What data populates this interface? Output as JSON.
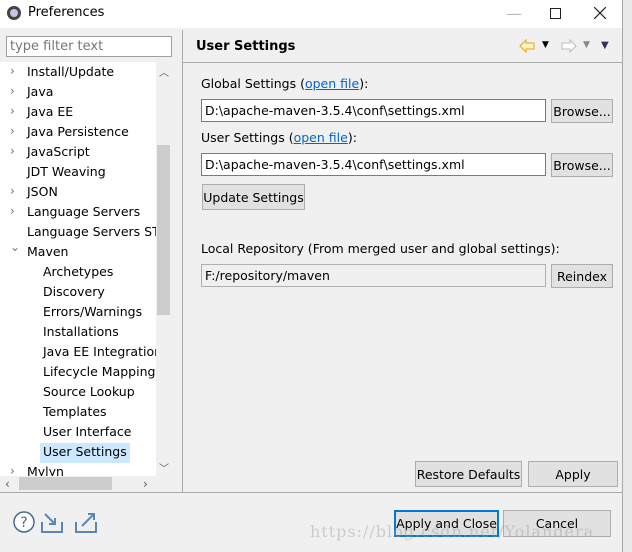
{
  "window": {
    "title": "Preferences",
    "app_icon": "eclipse-gear-icon"
  },
  "filter": {
    "placeholder": "type filter text",
    "value": ""
  },
  "tree": {
    "items": [
      {
        "label": "Install/Update",
        "level": 0,
        "expander": "collapsed"
      },
      {
        "label": "Java",
        "level": 0,
        "expander": "collapsed"
      },
      {
        "label": "Java EE",
        "level": 0,
        "expander": "collapsed"
      },
      {
        "label": "Java Persistence",
        "level": 0,
        "expander": "collapsed"
      },
      {
        "label": "JavaScript",
        "level": 0,
        "expander": "collapsed"
      },
      {
        "label": "JDT Weaving",
        "level": 0,
        "expander": "none"
      },
      {
        "label": "JSON",
        "level": 0,
        "expander": "collapsed"
      },
      {
        "label": "Language Servers",
        "level": 0,
        "expander": "collapsed"
      },
      {
        "label": "Language Servers STS",
        "level": 0,
        "expander": "none"
      },
      {
        "label": "Maven",
        "level": 0,
        "expander": "expanded"
      },
      {
        "label": "Archetypes",
        "level": 1
      },
      {
        "label": "Discovery",
        "level": 1
      },
      {
        "label": "Errors/Warnings",
        "level": 1
      },
      {
        "label": "Installations",
        "level": 1
      },
      {
        "label": "Java EE Integration",
        "level": 1
      },
      {
        "label": "Lifecycle Mappings",
        "level": 1
      },
      {
        "label": "Source Lookup",
        "level": 1
      },
      {
        "label": "Templates",
        "level": 1
      },
      {
        "label": "User Interface",
        "level": 1
      },
      {
        "label": "User Settings",
        "level": 1,
        "selected": true
      },
      {
        "label": "Mylyn",
        "level": 0,
        "expander": "collapsed"
      }
    ]
  },
  "page": {
    "title": "User Settings",
    "global": {
      "label": "Global Settings (",
      "link": "open file",
      "suffix": "):",
      "value": "D:\\apache-maven-3.5.4\\conf\\settings.xml",
      "browse": "Browse..."
    },
    "user": {
      "label": "User Settings (",
      "link": "open file",
      "suffix": "):",
      "value": "D:\\apache-maven-3.5.4\\conf\\settings.xml",
      "browse": "Browse..."
    },
    "update_button": "Update Settings",
    "local": {
      "label": "Local Repository (From merged user and global settings):",
      "value": "F:/repository/maven",
      "reindex": "Reindex"
    },
    "restore_defaults": "Restore Defaults",
    "apply": "Apply"
  },
  "footer": {
    "apply_close": "Apply and Close",
    "cancel": "Cancel"
  },
  "watermark": "https://blog.csdn.net/Yolandera",
  "colors": {
    "selection": "#cce8ff",
    "link": "#0066cc",
    "default_button_border": "#0078d7",
    "back_arrow": "#e8a317"
  }
}
